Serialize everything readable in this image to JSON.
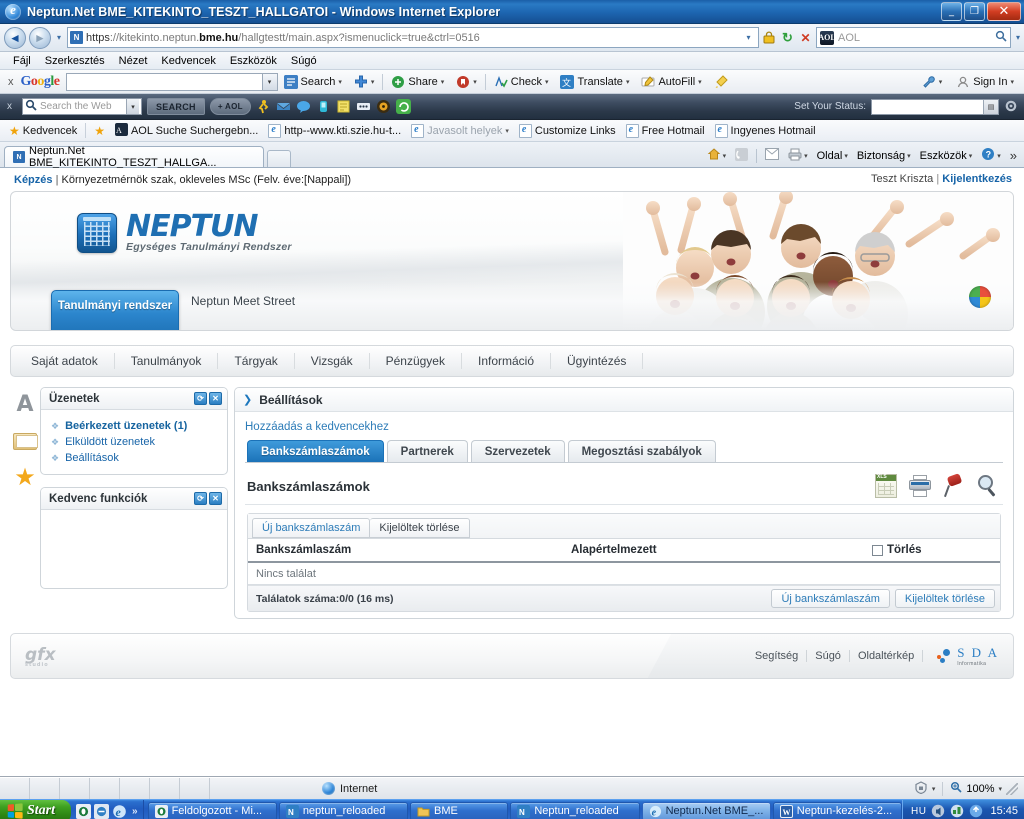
{
  "window": {
    "title": "Neptun.Net BME_KITEKINTO_TESZT_HALLGATOI - Windows Internet Explorer",
    "minimize": "_",
    "restore": "❐",
    "close": "✕"
  },
  "address_bar": {
    "back_icon": "◄",
    "forward_icon": "►",
    "history_arrow": "▾",
    "url_scheme": "https",
    "url_rest_1": "://kitekinto.neptun.",
    "url_domain": "bme.hu",
    "url_rest_2": "/hallgtestt/main.aspx?ismenuclick=true&ctrl=0516",
    "favicon_label": "N",
    "lock_icon": "🔒",
    "refresh_icon": "↻",
    "stop_icon": "✕",
    "search_provider": "AOL",
    "search_provider_icon": "AOL",
    "search_magnifier": "🔍"
  },
  "menubar": {
    "items": [
      "Fájl",
      "Szerkesztés",
      "Nézet",
      "Kedvencek",
      "Eszközök",
      "Súgó"
    ]
  },
  "google_toolbar": {
    "close_label": "x",
    "logo_letters": [
      "G",
      "o",
      "o",
      "g",
      "l",
      "e"
    ],
    "search_value": "",
    "dropdown_arrow": "▾",
    "items": [
      {
        "label": "Search",
        "caret": "▾"
      },
      {
        "label": "",
        "caret": "▾"
      },
      {
        "label": "Share",
        "caret": "▾"
      },
      {
        "label": "",
        "caret": "▾"
      },
      {
        "label": "Check",
        "caret": "▾"
      },
      {
        "label": "Translate",
        "caret": "▾"
      },
      {
        "label": "AutoFill",
        "caret": "▾"
      },
      {
        "label": "",
        "caret": ""
      }
    ],
    "right_items": [
      {
        "label": "",
        "caret": "▾"
      },
      {
        "label": "Sign In",
        "caret": "▾"
      }
    ]
  },
  "aol_toolbar": {
    "close_label": "x",
    "search_placeholder": "Search the Web",
    "search_value": "",
    "search_button": "SEARCH",
    "add_button": "+ AOL",
    "status_label": "Set Your Status:",
    "status_value": ""
  },
  "favorites_bar": {
    "label": "Kedvencek",
    "items": [
      {
        "label": "AOL Suche Suchergebn...",
        "dim": false
      },
      {
        "label": "http--www.kti.szie.hu-t...",
        "dim": false
      },
      {
        "label": "Javasolt helyek",
        "dim": true,
        "caret": "▾"
      },
      {
        "label": "Customize Links",
        "dim": false
      },
      {
        "label": "Free Hotmail",
        "dim": false
      },
      {
        "label": "Ingyenes Hotmail",
        "dim": false
      }
    ]
  },
  "tab_bar": {
    "tabs": [
      {
        "label": "Neptun.Net BME_KITEKINTO_TESZT_HALLGA..."
      }
    ],
    "right_items": [
      {
        "label": "",
        "icon": "home-icon",
        "caret": "▾"
      },
      {
        "label": "",
        "icon": "feed-icon",
        "caret": ""
      },
      {
        "label": "",
        "icon": "read-mail-icon",
        "caret": ""
      },
      {
        "label": "",
        "icon": "print-icon",
        "caret": "▾"
      },
      {
        "label": "Oldal",
        "caret": "▾"
      },
      {
        "label": "Biztonság",
        "caret": "▾"
      },
      {
        "label": "Eszközök",
        "caret": "▾"
      },
      {
        "label": "",
        "icon": "help-icon",
        "caret": "▾"
      }
    ],
    "overflow": "»"
  },
  "page": {
    "topbar": {
      "kepzes_label": "Képzés",
      "separator": "|",
      "kepzes_value": "Környezetmérnök szak, okleveles MSc (Felv. éve:[Nappali])",
      "user_name": "Teszt Kriszta",
      "user_sep": "|",
      "logout": "Kijelentkezés"
    },
    "banner": {
      "logo_title": "NEPTUN",
      "logo_subtitle": "Egységes Tanulmányi Rendszer",
      "active_tab": "Tanulmányi rendszer",
      "secondary_tab": "Neptun Meet Street"
    },
    "mainnav": [
      "Saját adatok",
      "Tanulmányok",
      "Tárgyak",
      "Vizsgák",
      "Pénzügyek",
      "Információ",
      "Ügyintézés"
    ],
    "sidebar": {
      "panels": [
        {
          "title": "Üzenetek",
          "refresh_icon": "⟳",
          "close_icon": "✕",
          "items": [
            {
              "label": "Beérkezett üzenetek (1)",
              "bold": true
            },
            {
              "label": "Elküldött üzenetek",
              "bold": false
            },
            {
              "label": "Beállítások",
              "bold": false
            }
          ]
        },
        {
          "title": "Kedvenc funkciók",
          "refresh_icon": "⟳",
          "close_icon": "✕",
          "items": []
        }
      ]
    },
    "main": {
      "header_arrow": "❯",
      "header_title": "Beállítások",
      "favorite_link": "Hozzáadás a kedvencekhez",
      "tabs": [
        {
          "label": "Bankszámlaszámok",
          "active": true
        },
        {
          "label": "Partnerek",
          "active": false
        },
        {
          "label": "Szervezetek",
          "active": false
        },
        {
          "label": "Megosztási szabályok",
          "active": false
        }
      ],
      "section_title": "Bankszámlaszámok",
      "section_icons": [
        "xls-export-icon",
        "print-icon",
        "pin-icon",
        "magnifier-icon"
      ],
      "table": {
        "toolbar_buttons": [
          "Új bankszámlaszám",
          "Kijelöltek törlése"
        ],
        "columns": [
          "Bankszámlaszám",
          "Alapértelmezett",
          "Törlés"
        ],
        "rows": [],
        "empty_text": "Nincs találat",
        "footer_count": "Találatok száma:0/0 (16 ms)",
        "footer_buttons": [
          "Új bankszámlaszám",
          "Kijelöltek törlése"
        ]
      }
    },
    "footer": {
      "brand": "gfx",
      "brand_sub": "studio",
      "links": [
        "Segítség",
        "Súgó",
        "Oldaltérkép"
      ],
      "company": "S D A",
      "company_sub": "Informatika"
    }
  },
  "statusbar": {
    "zone": "Internet",
    "protected_caret": "▾",
    "zoom": "100%",
    "zoom_caret": "▾"
  },
  "taskbar": {
    "start": "Start",
    "quicklaunch_overflow": "»",
    "tasks": [
      {
        "label": "Feldolgozott - Mi...",
        "active": false,
        "icon": "outlook-icon"
      },
      {
        "label": "neptun_reloaded",
        "active": false,
        "icon": "neptun-icon"
      },
      {
        "label": "BME",
        "active": false,
        "icon": "folder-icon"
      },
      {
        "label": "Neptun_reloaded",
        "active": false,
        "icon": "neptun-icon"
      },
      {
        "label": "Neptun.Net BME_...",
        "active": true,
        "icon": "ie-icon"
      },
      {
        "label": "Neptun-kezelés-2...",
        "active": false,
        "icon": "word-icon"
      }
    ],
    "language": "HU",
    "clock": "15:45"
  }
}
